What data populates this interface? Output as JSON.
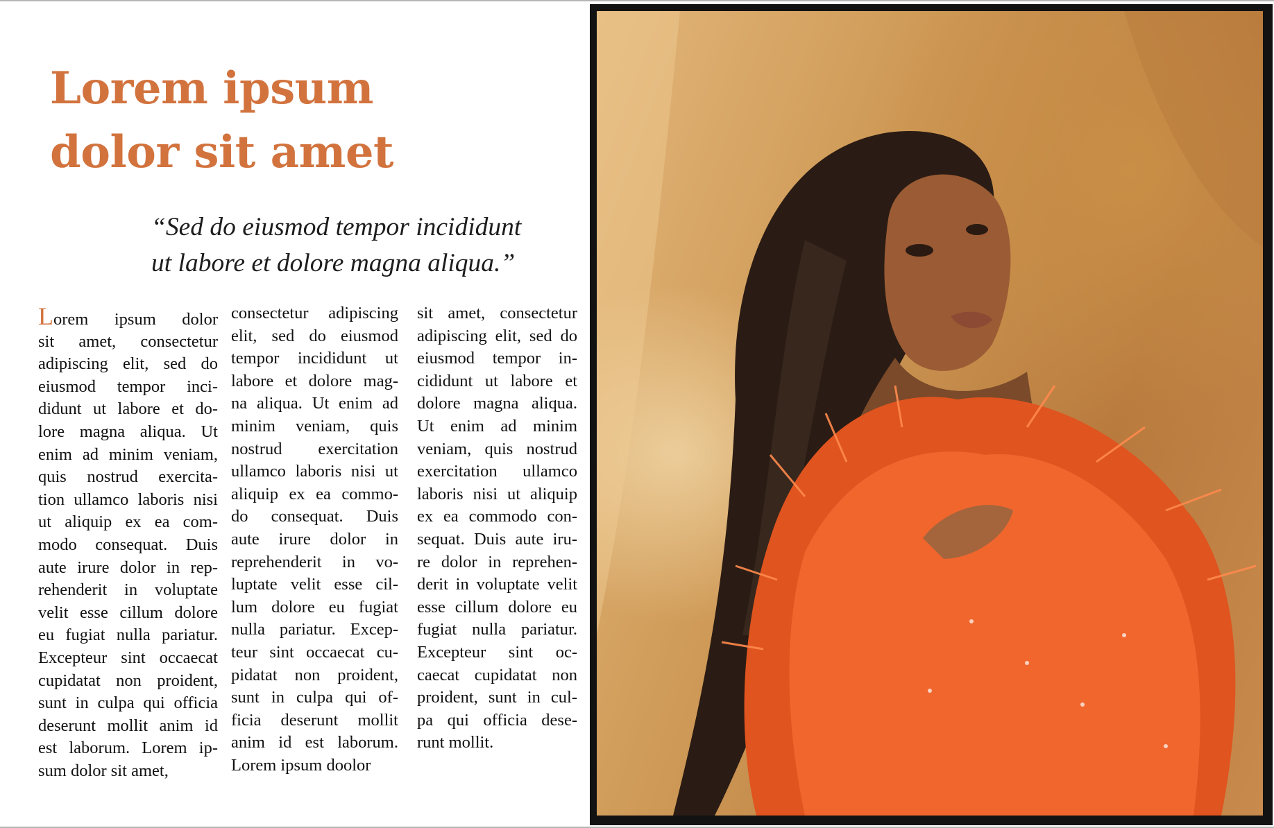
{
  "headline": {
    "line1": "Lorem ipsum",
    "line2": "dolor sit amet"
  },
  "pullquote": {
    "line1": "“Sed do eiusmod tempor incididunt",
    "line2": "ut labore et dolore magna aliqua.”"
  },
  "columns": {
    "col1": {
      "dropcap": "L",
      "first_rest": "orem ipsum dolor",
      "lines": [
        "sit amet, consectetur",
        "adipiscing elit, sed do",
        "eiusmod tempor inci-",
        "didunt ut labore et do-",
        "lore magna aliqua. Ut",
        "enim ad minim veniam,",
        "quis nostrud exercita-",
        "tion ullamco laboris nisi",
        "ut aliquip ex ea com-",
        "modo consequat. Duis",
        "aute irure dolor in rep-",
        "rehenderit in voluptate",
        "velit esse cillum dolore",
        "eu fugiat nulla pariatur.",
        "Excepteur sint occaecat",
        "cupidatat non proident,",
        "sunt in culpa qui officia",
        "deserunt mollit anim id",
        "est laborum. Lorem ip-",
        "sum dolor sit amet,"
      ]
    },
    "col2": {
      "lines": [
        "consectetur adipiscing",
        "elit, sed do eiusmod",
        "tempor incididunt ut",
        "labore et dolore mag-",
        "na aliqua. Ut enim ad",
        "minim veniam, quis",
        "nostrud exercitation",
        "ullamco laboris nisi ut",
        "aliquip ex ea commo-",
        "do consequat. Duis",
        "aute irure dolor in",
        "reprehenderit in vo-",
        "luptate velit esse cil-",
        "lum dolore eu fugiat",
        "nulla pariatur. Excep-",
        "teur sint occaecat cu-",
        "pidatat non proident,",
        "sunt in culpa qui of-",
        "ficia deserunt mollit",
        "anim id est laborum.",
        "Lorem ipsum doolor"
      ]
    },
    "col3": {
      "lines": [
        "sit amet, consectetur",
        "adipiscing elit, sed do",
        "eiusmod tempor in-",
        "cididunt ut labore et",
        "dolore magna aliqua.",
        "Ut enim ad minim",
        "veniam, quis nostrud",
        "exercitation ullamco",
        "laboris nisi ut aliquip",
        "ex ea commodo con-",
        "sequat. Duis aute iru-",
        "re dolor in reprehen-",
        "derit in voluptate velit",
        "esse cillum dolore eu",
        "fugiat nulla pariatur.",
        "Excepteur sint oc-",
        "caecat cupidatat non",
        "proident, sunt in cul-",
        "pa qui officia dese-",
        "runt mollit."
      ]
    }
  },
  "colors": {
    "accent": "#d2733e",
    "text": "#111111",
    "frame": "#121212"
  }
}
